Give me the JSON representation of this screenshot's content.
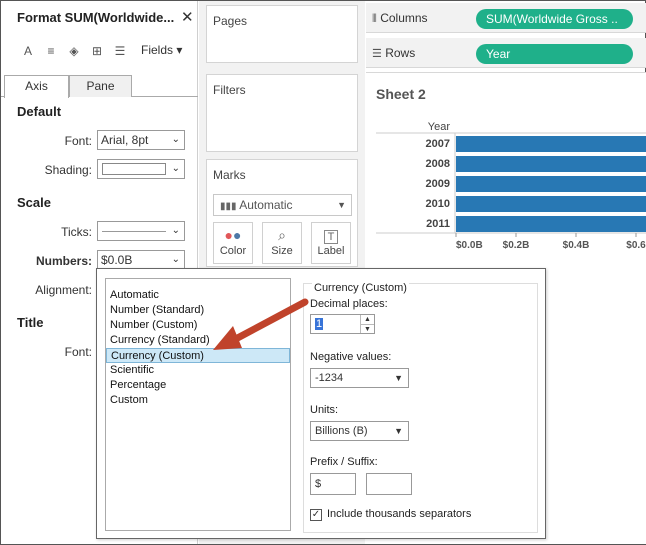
{
  "format_pane": {
    "title": "Format SUM(Worldwide...",
    "close_glyph": "✕",
    "toolbar": {
      "font_glyph": "A",
      "align_glyph": "≡",
      "shading_glyph": "◈",
      "borders_glyph": "⊞",
      "lines_glyph": "☰",
      "fields_label": "Fields ▾"
    },
    "tabs": [
      "Axis",
      "Pane"
    ],
    "default_head": "Default",
    "font_label": "Font:",
    "font_value": "Arial, 8pt",
    "shading_label": "Shading:",
    "scale_head": "Scale",
    "ticks_label": "Ticks:",
    "numbers_label": "Numbers:",
    "numbers_value": "$0.0B",
    "alignment_label": "Alignment:",
    "title_head": "Title",
    "title_font_label": "Font:"
  },
  "shelves": {
    "pages": "Pages",
    "filters": "Filters",
    "marks": "Marks",
    "marks_type": "Automatic",
    "marks_buttons": [
      "Color",
      "Size",
      "Label"
    ],
    "columns_label": "Columns",
    "columns_pill": "SUM(Worldwide Gross ..",
    "rows_label": "Rows",
    "rows_pill": "Year"
  },
  "sheet": {
    "title": "Sheet 2"
  },
  "chart_data": {
    "type": "bar",
    "orientation": "horizontal",
    "row_header": "Year",
    "categories": [
      "2007",
      "2008",
      "2009",
      "2010",
      "2011"
    ],
    "x_tick_labels": [
      "$0.0B",
      "$0.2B",
      "$0.4B",
      "$0.6"
    ],
    "bar_color": "#2878b4",
    "note": ""
  },
  "number_format_popup": {
    "options": [
      "Automatic",
      "Number (Standard)",
      "Number (Custom)",
      "Currency (Standard)",
      "Currency (Custom)",
      "Scientific",
      "Percentage",
      "Custom"
    ],
    "selected_index": 4,
    "group_title": "Currency (Custom)",
    "decimal_label": "Decimal places:",
    "decimal_value": "1",
    "negative_label": "Negative values:",
    "negative_value": "-1234",
    "units_label": "Units:",
    "units_value": "Billions (B)",
    "prefix_label": "Prefix / Suffix:",
    "prefix_value": "$",
    "suffix_value": "",
    "thousands_label": "Include thousands separators",
    "thousands_checked": true
  },
  "colors": {
    "pill_green": "#1fb08a",
    "bar_blue": "#2878b4",
    "arrow_red": "#c0432b"
  }
}
